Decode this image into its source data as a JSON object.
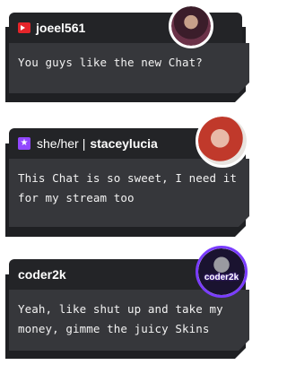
{
  "messages": [
    {
      "username": "joeel561",
      "badge_icon": "camera-icon",
      "badge_color": "#e5252a",
      "text": "You guys like the new Chat?"
    },
    {
      "pronouns": "she/her",
      "separator": "|",
      "username": "staceylucia",
      "badge_icon": "star-icon",
      "badge_glyph": "★",
      "badge_color": "#9147ff",
      "text": "This Chat is so sweet, I need it for my stream too"
    },
    {
      "username": "coder2k",
      "avatar_text": "coder2k",
      "text": "Yeah, like shut up and take my money, gimme the juicy Skins"
    }
  ],
  "colors": {
    "header_bg": "#232427",
    "body_bg": "#36373b",
    "shadow": "#1f2023",
    "text": "#f2f2f2"
  }
}
